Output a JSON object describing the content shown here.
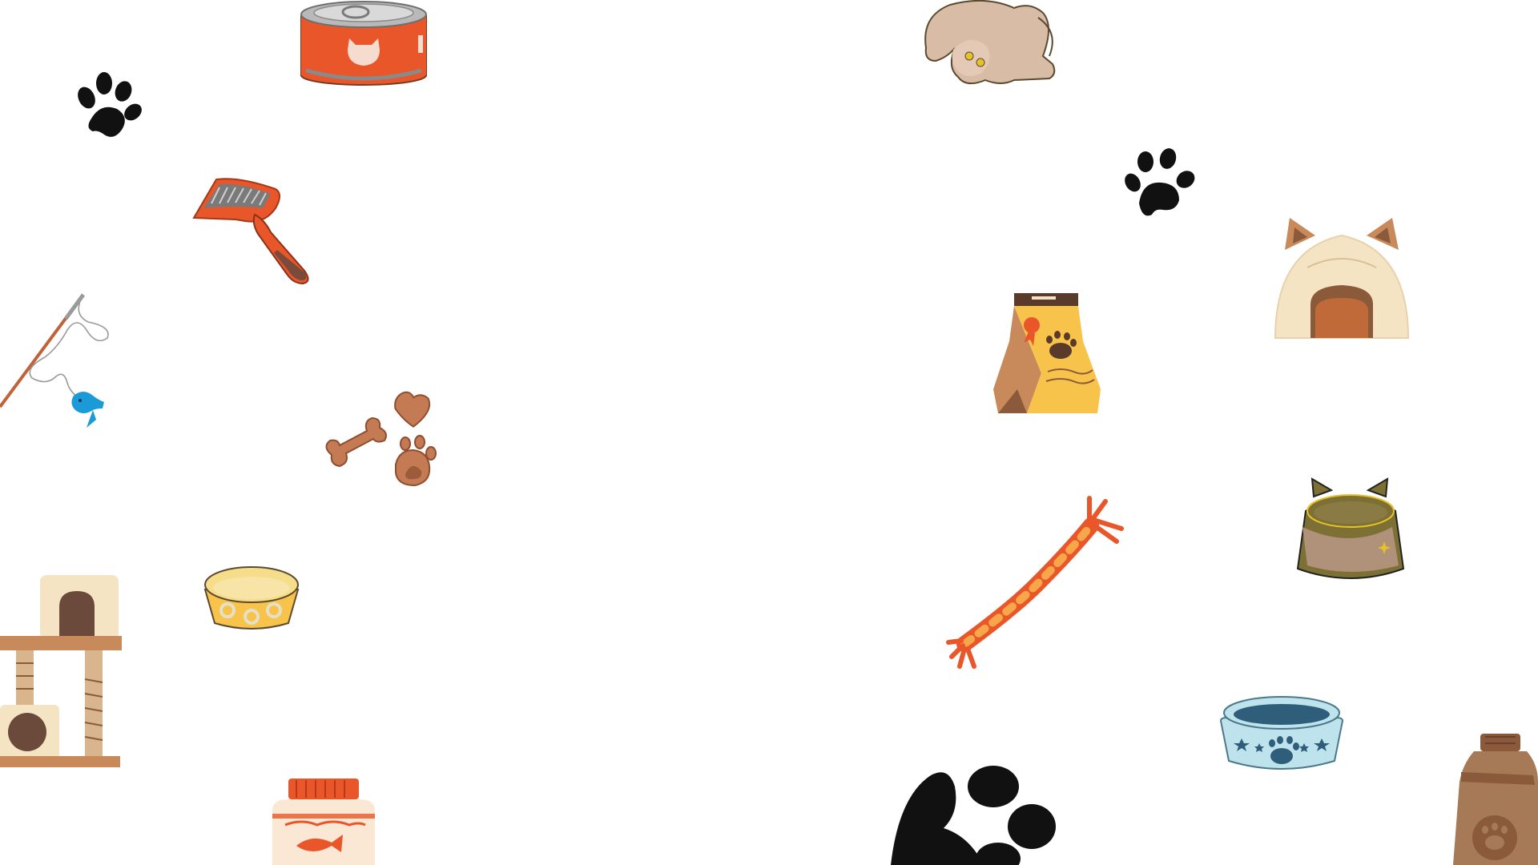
{
  "canvas": {
    "background": "#ffffff",
    "theme": "cat supplies decorative background"
  },
  "illustrations": [
    {
      "name": "cat-food-can-icon"
    },
    {
      "name": "paw-print-icon"
    },
    {
      "name": "slicker-brush-icon"
    },
    {
      "name": "fishing-rod-cat-toy-icon"
    },
    {
      "name": "cat-treats-icon"
    },
    {
      "name": "yellow-food-bowl-icon"
    },
    {
      "name": "cat-tree-icon"
    },
    {
      "name": "fish-food-jar-icon"
    },
    {
      "name": "stretching-cat-icon"
    },
    {
      "name": "cat-bed-icon"
    },
    {
      "name": "food-bag-icon"
    },
    {
      "name": "rope-toy-icon"
    },
    {
      "name": "cat-ear-bowl-icon"
    },
    {
      "name": "blue-paw-bowl-icon"
    },
    {
      "name": "brown-bottle-icon"
    }
  ],
  "colors": {
    "orange": "#e8562a",
    "black": "#111111",
    "tan": "#c98a5b",
    "yellow": "#f7c34a",
    "blue": "#1a9ad6",
    "light_blue": "#bfe3ec",
    "olive": "#7d7035",
    "cream": "#f4e4c4",
    "cat_beige": "#d9bca5"
  }
}
